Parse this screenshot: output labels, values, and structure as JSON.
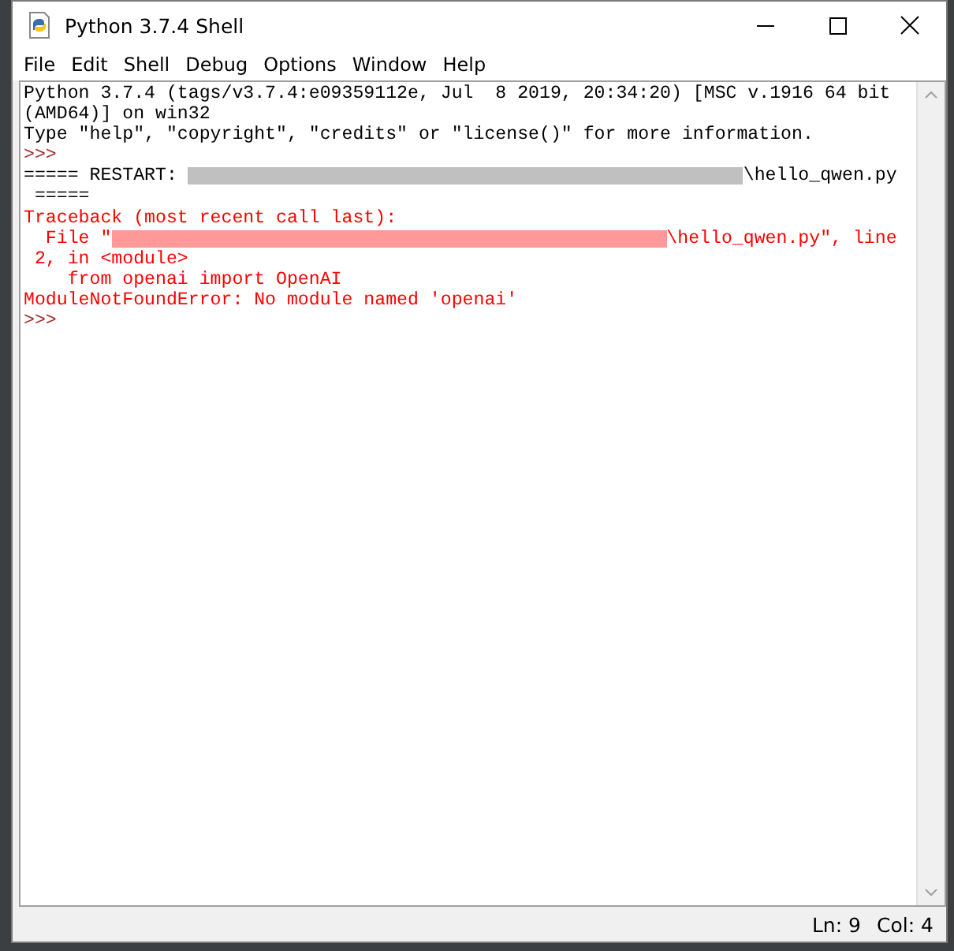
{
  "window": {
    "title": "Python 3.7.4 Shell"
  },
  "menu": [
    "File",
    "Edit",
    "Shell",
    "Debug",
    "Options",
    "Window",
    "Help"
  ],
  "shell_lines": [
    {
      "segments": [
        {
          "kind": "text",
          "color": "#000000",
          "text": "Python 3.7.4 (tags/v3.7.4:e09359112e, Jul  8 2019, 20:34:20) [MSC v.1916 64 bit"
        }
      ]
    },
    {
      "segments": [
        {
          "kind": "text",
          "color": "#000000",
          "text": "(AMD64)] on win32"
        }
      ]
    },
    {
      "segments": [
        {
          "kind": "text",
          "color": "#000000",
          "text": "Type \"help\", \"copyright\", \"credits\" or \"license()\" for more information."
        }
      ]
    },
    {
      "segments": [
        {
          "kind": "prompt",
          "color": "#a52a2a",
          "text": ">>>"
        }
      ]
    },
    {
      "segments": [
        {
          "kind": "text",
          "color": "#000000",
          "text": "===== RESTART: "
        },
        {
          "kind": "redacted",
          "color": "#c0c0c0"
        },
        {
          "kind": "text",
          "color": "#000000",
          "text": "\\hello_qwen.py"
        }
      ]
    },
    {
      "segments": [
        {
          "kind": "text",
          "color": "#000000",
          "text": " ====="
        }
      ]
    },
    {
      "segments": [
        {
          "kind": "text",
          "color": "#ff0000",
          "text": "Traceback (most recent call last):"
        }
      ]
    },
    {
      "segments": [
        {
          "kind": "text",
          "color": "#ff0000",
          "text": "  File \""
        },
        {
          "kind": "redacted",
          "color": "#ff9999"
        },
        {
          "kind": "text",
          "color": "#ff0000",
          "text": "\\hello_qwen.py\", line"
        }
      ]
    },
    {
      "segments": [
        {
          "kind": "text",
          "color": "#ff0000",
          "text": " 2, in <module>"
        }
      ]
    },
    {
      "segments": [
        {
          "kind": "text",
          "color": "#ff0000",
          "text": "    from openai import OpenAI"
        }
      ]
    },
    {
      "segments": [
        {
          "kind": "text",
          "color": "#ff0000",
          "text": "ModuleNotFoundError: No module named 'openai'"
        }
      ]
    },
    {
      "segments": [
        {
          "kind": "prompt",
          "color": "#a52a2a",
          "text": ">>>"
        }
      ]
    }
  ],
  "status_bar": {
    "line": "Ln: 9",
    "column": "Col: 4"
  }
}
